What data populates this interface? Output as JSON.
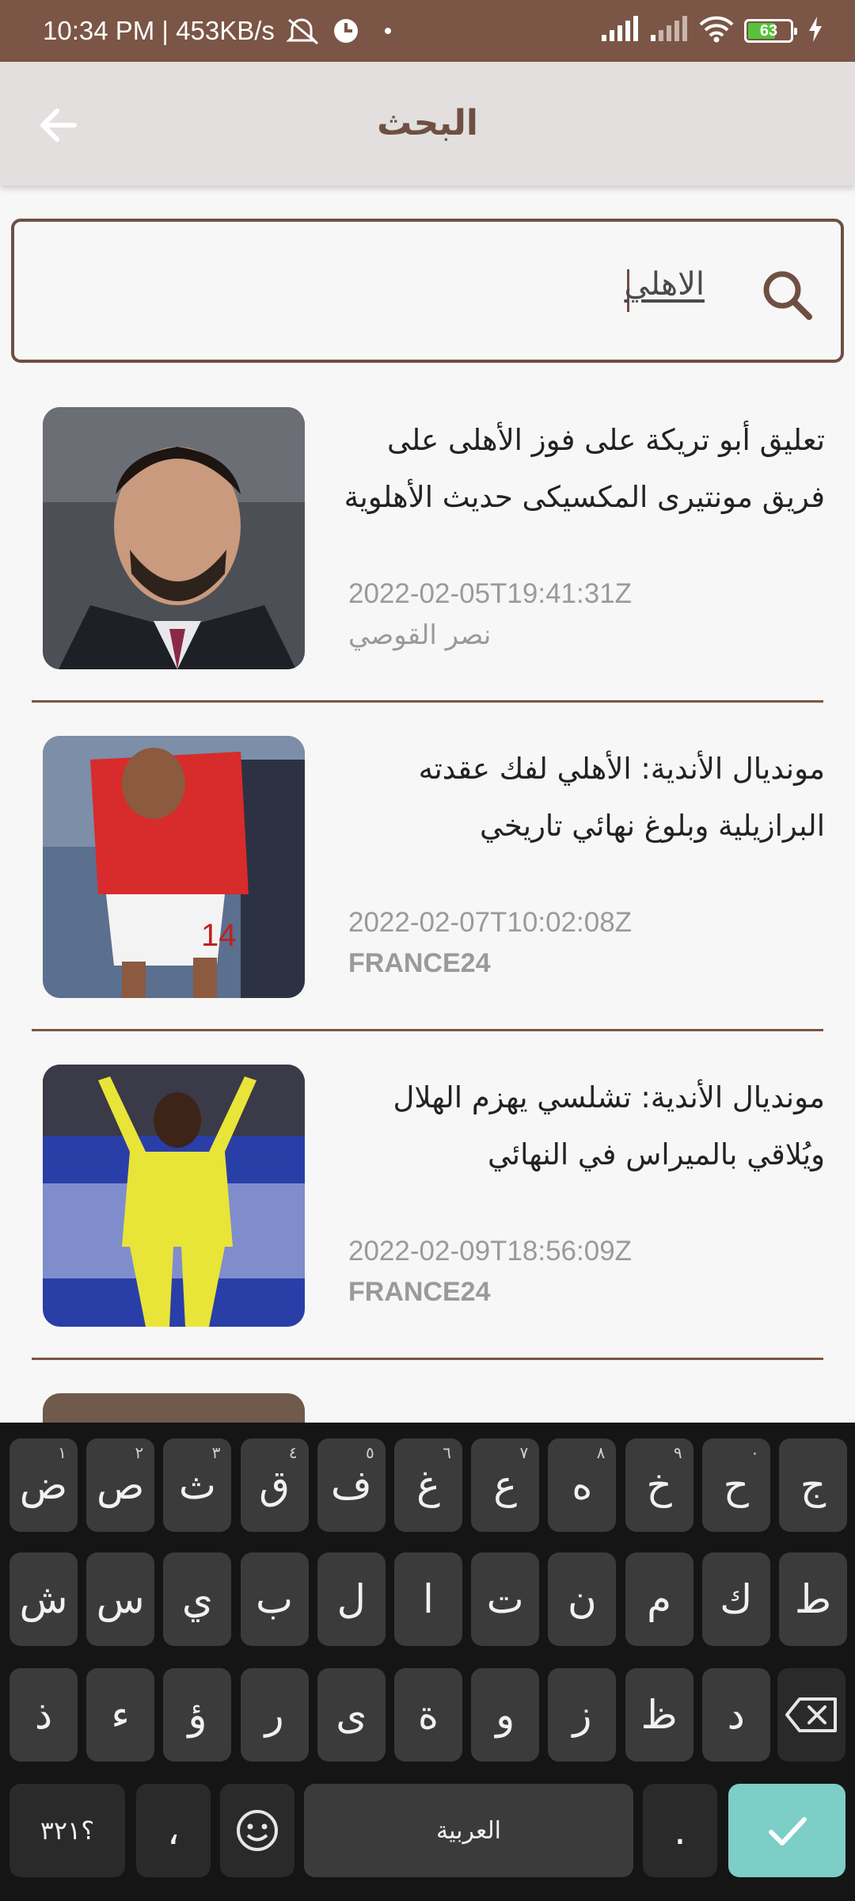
{
  "status_bar": {
    "time_speed": "10:34 PM | 453KB/s",
    "battery_level": "63"
  },
  "app_bar": {
    "title": "البحث"
  },
  "search": {
    "query": "الاهلي"
  },
  "results": [
    {
      "headline": "تعليق أبو تريكة على فوز الأهلى على فريق مونتيرى المكسيكى حديث الأهلوية",
      "date": "2022-02-05T19:41:31Z",
      "source": "نصر القوصي"
    },
    {
      "headline": "مونديال الأندية: الأهلي لفك عقدته البرازيلية وبلوغ نهائي تاريخي",
      "date": "2022-02-07T10:02:08Z",
      "source": "FRANCE24"
    },
    {
      "headline": "مونديال الأندية: تشلسي يهزم الهلال ويُلاقي بالميراس في النهائي",
      "date": "2022-02-09T18:56:09Z",
      "source": "FRANCE24"
    }
  ],
  "keyboard": {
    "row1": [
      {
        "k": "ض",
        "n": "١"
      },
      {
        "k": "ص",
        "n": "٢"
      },
      {
        "k": "ث",
        "n": "٣"
      },
      {
        "k": "ق",
        "n": "٤"
      },
      {
        "k": "ف",
        "n": "٥"
      },
      {
        "k": "غ",
        "n": "٦"
      },
      {
        "k": "ع",
        "n": "٧"
      },
      {
        "k": "ه",
        "n": "٨"
      },
      {
        "k": "خ",
        "n": "٩"
      },
      {
        "k": "ح",
        "n": "٠"
      },
      {
        "k": "ج",
        "n": ""
      }
    ],
    "row2": [
      "ش",
      "س",
      "ي",
      "ب",
      "ل",
      "ا",
      "ت",
      "ن",
      "م",
      "ك",
      "ط"
    ],
    "row3": [
      "ذ",
      "ء",
      "ؤ",
      "ر",
      "ى",
      "ة",
      "و",
      "ز",
      "ظ",
      "د"
    ],
    "numbers_key": "؟٣٢١",
    "comma_key": "،",
    "space_label": "العربية",
    "period_key": "."
  }
}
